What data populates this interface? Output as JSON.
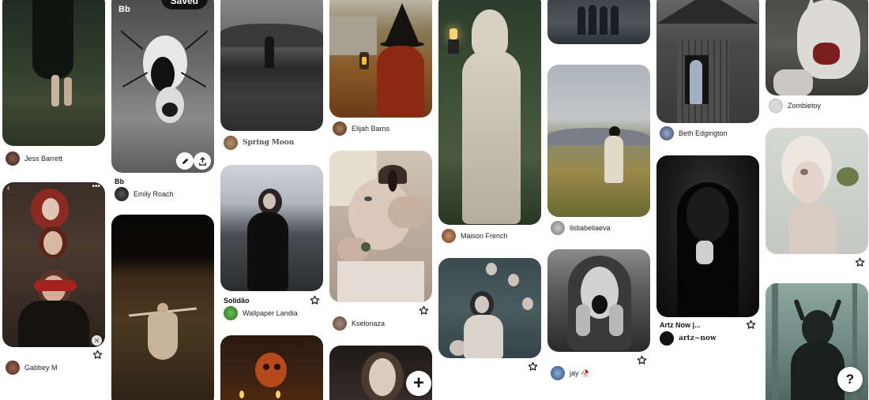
{
  "pins": {
    "c1a": {
      "author": "Jess Barrett"
    },
    "c1b": {
      "author": "Gabbey M"
    },
    "c2a": {
      "board_label": "Bb",
      "saved_label": "Saved",
      "title": "Bb",
      "author": "Emily Roach"
    },
    "c3a": {
      "author": "Spring Moon"
    },
    "c3b": {
      "title": "Solidão",
      "author": "Wallpaper Landia"
    },
    "c4a": {
      "author": "Elijah Barns"
    },
    "c4b": {
      "author": "Kselonaza"
    },
    "c5a": {
      "author": "Maison French"
    },
    "c6b": {
      "author": "llidiabeliaeva"
    },
    "c6c": {
      "author": "jay 🥀"
    },
    "c7a": {
      "author": "Beth Edgington"
    },
    "c7b": {
      "title": "Artz Now |...",
      "author": "artz~now"
    },
    "c8a": {
      "author": "Zombietoy"
    }
  },
  "fab_add_label": "+",
  "help_label": "?"
}
